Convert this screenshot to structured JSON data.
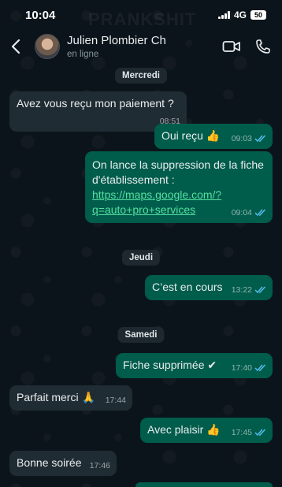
{
  "status": {
    "time": "10:04",
    "network": "4G",
    "battery": "50",
    "watermark": "PRANKSHIT"
  },
  "header": {
    "contact_name": "Julien Plombier Ch",
    "contact_status": "en ligne"
  },
  "messages": {
    "day1": "Mercredi",
    "m1": {
      "text": "Avez vous reçu mon paiement ?",
      "time": "08:51"
    },
    "m2": {
      "text": "Oui reçu 👍",
      "time": "09:03"
    },
    "m3": {
      "text": "On lance la suppression de la fiche d'établissement :",
      "link": "https://maps.google.com/?q=auto+pro+services",
      "link_line1": "https://maps.google.com/?",
      "link_line2": "q=auto+pro+services",
      "time": "09:04"
    },
    "day2": "Jeudi",
    "m4": {
      "text": "C’est en cours",
      "time": "13:22"
    },
    "day3": "Samedi",
    "m5": {
      "text": "Fiche supprimée ✔",
      "time": "17:40"
    },
    "m6": {
      "text": "Parfait merci 🙏",
      "time": "17:44"
    },
    "m7": {
      "text": "Avec plaisir 👍",
      "time": "17:45"
    },
    "m8": {
      "text": "Bonne soirée",
      "time": "17:46"
    }
  },
  "colors": {
    "incoming": "#202c33",
    "outgoing": "#005c4b",
    "read_tick": "#53bdeb",
    "background": "#0b141a"
  },
  "icons": [
    "back-arrow-icon",
    "video-call-icon",
    "phone-icon",
    "double-tick-icon",
    "signal-icon",
    "battery-icon"
  ]
}
